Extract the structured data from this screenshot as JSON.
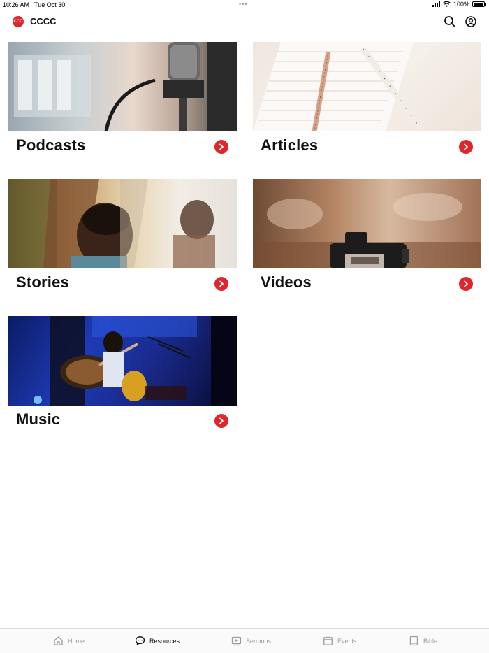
{
  "status_bar": {
    "time": "10:26 AM",
    "date": "Tue Oct 30",
    "dots": "•••",
    "battery": "100%"
  },
  "header": {
    "logo_text": "CCC",
    "title": "CCCC",
    "icons": [
      "search-icon",
      "account-icon"
    ]
  },
  "cards": [
    {
      "title": "Podcasts"
    },
    {
      "title": "Articles"
    },
    {
      "title": "Stories"
    },
    {
      "title": "Videos"
    },
    {
      "title": "Music"
    }
  ],
  "tabs": [
    {
      "label": "Home",
      "icon": "home-icon",
      "active": false
    },
    {
      "label": "Resources",
      "icon": "chat-bubble-icon",
      "active": true
    },
    {
      "label": "Sermons",
      "icon": "play-video-icon",
      "active": false
    },
    {
      "label": "Events",
      "icon": "calendar-icon",
      "active": false
    },
    {
      "label": "Bible",
      "icon": "book-icon",
      "active": false
    }
  ],
  "colors": {
    "accent": "#e0262d",
    "text": "#111111",
    "inactive_tab": "#9a9a9a"
  }
}
